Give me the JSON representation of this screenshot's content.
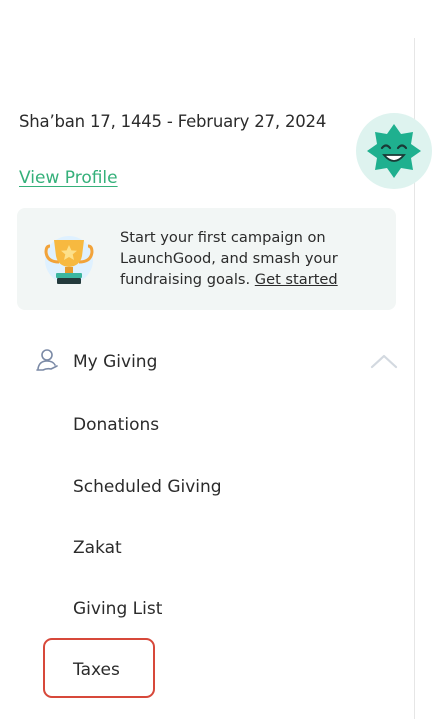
{
  "profile": {
    "date": "Sha’ban 17, 1445 - February 27, 2024",
    "view_profile_label": "View Profile",
    "avatar_icon": "smiling-star-avatar-icon"
  },
  "promo": {
    "text": "Start your first campaign on LaunchGood, and smash your fundraising goals.",
    "link_label": "Get started",
    "icon": "trophy-icon"
  },
  "nav": {
    "section_label": "My Giving",
    "section_icon": "user-hand-icon",
    "expanded": true,
    "items": [
      {
        "label": "Donations"
      },
      {
        "label": "Scheduled Giving"
      },
      {
        "label": "Zakat"
      },
      {
        "label": "Giving List"
      },
      {
        "label": "Taxes",
        "highlighted": true
      }
    ]
  },
  "colors": {
    "link_green": "#35b07a",
    "promo_bg": "#f2f6f5",
    "highlight": "#d7483a",
    "avatar_bg": "#def3ef",
    "avatar_star": "#1fb08f"
  }
}
